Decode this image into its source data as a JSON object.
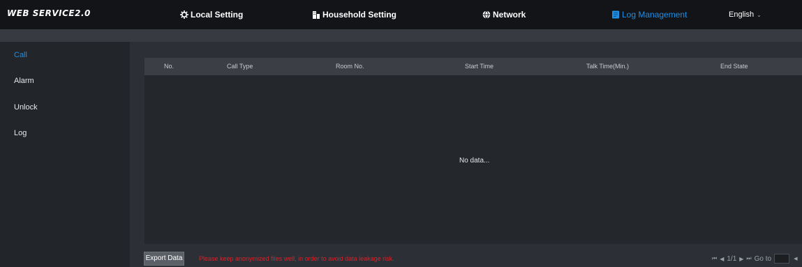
{
  "header": {
    "logo": "WEB SERVICE2.0",
    "nav": [
      {
        "label": "Local Setting",
        "icon": "gear-icon"
      },
      {
        "label": "Household Setting",
        "icon": "building-icon"
      },
      {
        "label": "Network",
        "icon": "globe-icon"
      },
      {
        "label": "Log Management",
        "icon": "log-icon"
      }
    ],
    "active_nav": "Log Management",
    "language": "English"
  },
  "sidebar": {
    "items": [
      {
        "label": "Call"
      },
      {
        "label": "Alarm"
      },
      {
        "label": "Unlock"
      },
      {
        "label": "Log"
      }
    ],
    "active": "Call"
  },
  "table": {
    "columns": [
      "No.",
      "Call Type",
      "Room No.",
      "Start Time",
      "Talk Time(Min.)",
      "End State"
    ],
    "empty_text": "No data..."
  },
  "footer": {
    "export_label": "Export Data",
    "warning": "Please keep anonymized files well, in order to avoid data leakage risk.",
    "pagination": "1/1",
    "goto_label": "Go to",
    "goto_value": ""
  },
  "colors": {
    "accent": "#1e8fe6",
    "warning": "#d8232a",
    "topbar": "#121418"
  }
}
